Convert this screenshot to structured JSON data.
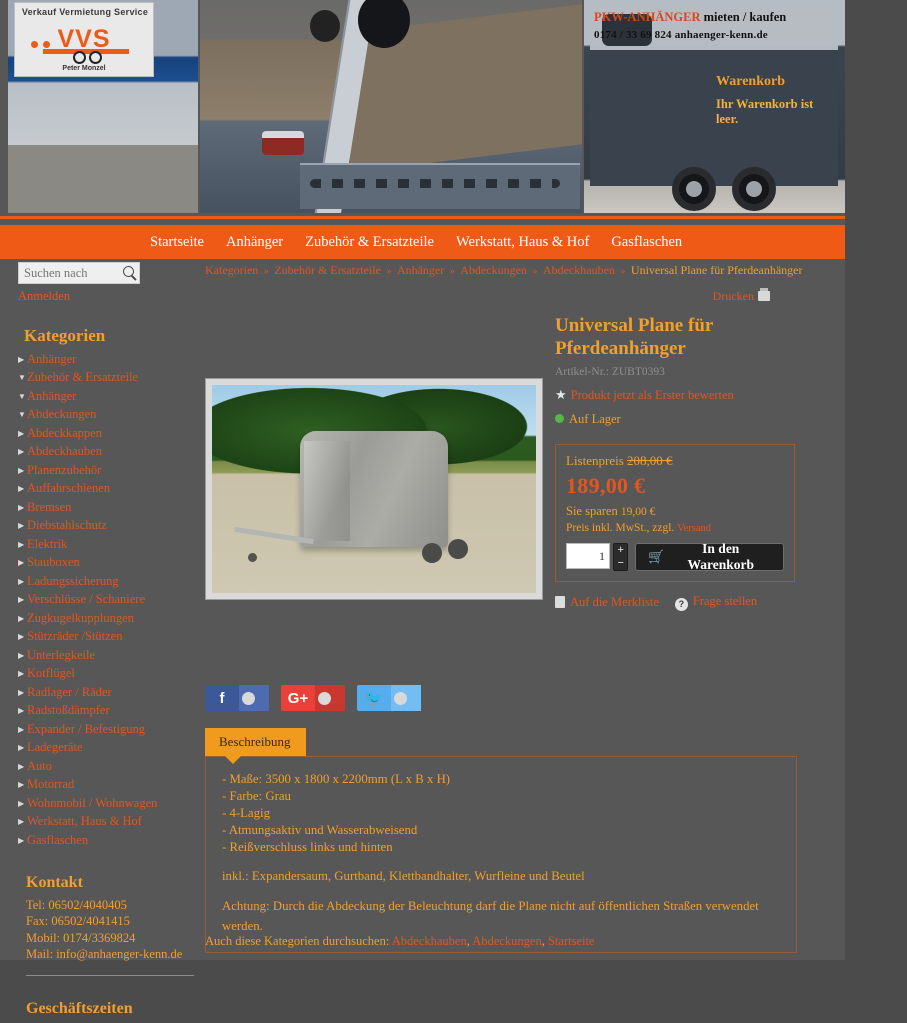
{
  "header": {
    "logo": {
      "arc_text": "Verkauf  Vermietung  Service",
      "brand": "VVS",
      "sub": "Peter Monzel"
    },
    "promo_line1_highlight": "PKW-ANHÄNGER",
    "promo_line1_rest": " mieten / kaufen",
    "promo_line2": "0174 / 33 69 824    anhaenger-kenn.de",
    "cart_title": "Warenkorb",
    "cart_message": "Ihr Warenkorb ist leer."
  },
  "nav": {
    "items": [
      "Startseite",
      "Anhänger",
      "Zubehör & Ersatzteile",
      "Werkstatt, Haus & Hof",
      "Gasflaschen"
    ]
  },
  "search": {
    "placeholder": "Suchen nach",
    "value": "",
    "login_label": "Anmelden"
  },
  "sidebar": {
    "categories_heading": "Kategorien",
    "items": [
      {
        "label": "Anhänger",
        "level": 0,
        "marker": "right"
      },
      {
        "label": "Zubehör & Ersatzteile",
        "level": 0,
        "marker": "down"
      },
      {
        "label": "Anhänger",
        "level": 1,
        "marker": "down"
      },
      {
        "label": "Abdeckungen",
        "level": 2,
        "marker": "down"
      },
      {
        "label": "Abdeckkappen",
        "level": 3,
        "marker": "right"
      },
      {
        "label": "Abdeckhauben",
        "level": 3,
        "marker": "right"
      },
      {
        "label": "Planenzubehör",
        "level": 3,
        "marker": "right"
      },
      {
        "label": "Auffahrschienen",
        "level": 2,
        "marker": "right"
      },
      {
        "label": "Bremsen",
        "level": 2,
        "marker": "right"
      },
      {
        "label": "Diebstahlschutz",
        "level": 2,
        "marker": "right"
      },
      {
        "label": "Elektrik",
        "level": 2,
        "marker": "right"
      },
      {
        "label": "Stauboxen",
        "level": 2,
        "marker": "right"
      },
      {
        "label": "Ladungssicherung",
        "level": 2,
        "marker": "right"
      },
      {
        "label": "Verschlüsse / Schaniere",
        "level": 2,
        "marker": "right"
      },
      {
        "label": "Zugkugelkupplungen",
        "level": 2,
        "marker": "right"
      },
      {
        "label": "Stützräder /Stützen",
        "level": 2,
        "marker": "right"
      },
      {
        "label": "Unterlegkeile",
        "level": 2,
        "marker": "right"
      },
      {
        "label": "Kotflügel",
        "level": 2,
        "marker": "right"
      },
      {
        "label": "Radlager / Räder",
        "level": 2,
        "marker": "right"
      },
      {
        "label": "Radstoßdämpfer",
        "level": 2,
        "marker": "right"
      },
      {
        "label": "Expander / Befestigung",
        "level": 2,
        "marker": "right"
      },
      {
        "label": "Ladegeräte",
        "level": 2,
        "marker": "right"
      },
      {
        "label": "Auto",
        "level": 1,
        "marker": "right"
      },
      {
        "label": "Motorrad",
        "level": 1,
        "marker": "right"
      },
      {
        "label": "Wohnmobil / Wohnwagen",
        "level": 1,
        "marker": "right"
      },
      {
        "label": "Werkstatt, Haus & Hof",
        "level": 0,
        "marker": "right"
      },
      {
        "label": "Gasflaschen",
        "level": 0,
        "marker": "right"
      }
    ],
    "contact_heading": "Kontakt",
    "contact_lines": [
      "Tel: 06502/4040405",
      "Fax: 06502/4041415",
      "Mobil: 0174/3369824",
      "Mail: info@anhaenger-kenn.de"
    ],
    "hours_heading": "Geschäftszeiten"
  },
  "breadcrumb": {
    "items": [
      "Kategorien",
      "Zubehör & Ersatzteile",
      "Anhänger",
      "Abdeckungen",
      "Abdeckhauben"
    ],
    "current": "Universal Plane für Pferdeanhänger",
    "separator": "»",
    "print_label": "Drucken"
  },
  "product": {
    "title": "Universal Plane für Pferdeanhänger",
    "article_label": "Artikel-Nr.: ZUBT0393",
    "review_link": "Produkt jetzt als Erster bewerten",
    "stock_label": "Auf Lager",
    "list_price_label": "Listenpreis",
    "list_price": "208,00 €",
    "price": "189,00 €",
    "savings_label": "Sie sparen",
    "savings_amount": "19,00 €",
    "tax_note": "Preis inkl. MwSt., zzgl.",
    "shipping_link": "Versand",
    "quantity": "1",
    "plus_label": "+",
    "minus_label": "−",
    "add_to_cart_label": "In den Warenkorb",
    "wishlist_label": "Auf die Merkliste",
    "question_label": "Frage stellen"
  },
  "social": [
    {
      "network": "facebook",
      "glyph": "f"
    },
    {
      "network": "google-plus",
      "glyph": "G+"
    },
    {
      "network": "twitter",
      "glyph": "🐦"
    }
  ],
  "description": {
    "tab_label": "Beschreibung",
    "specs": [
      "- Maße: 3500 x 1800 x 2200mm (L x B x H)",
      "- Farbe: Grau",
      "- 4-Lagig",
      "- Atmungsaktiv und Wasserabweisend",
      "- Reißverschluss links und hinten"
    ],
    "included": "inkl.: Expandersaum, Gurtband, Klettbandhalter, Wurfleine und Beutel",
    "warning": "Achtung: Durch die Abdeckung der Beleuchtung darf die Plane nicht auf öffentlichen Straßen verwendet werden."
  },
  "also_browse": {
    "label": "Auch diese Kategorien durchsuchen:",
    "links": [
      "Abdeckhauben",
      "Abdeckungen",
      "Startseite"
    ]
  },
  "colors": {
    "orange": "#ef5a17",
    "link": "#e4551f",
    "amber": "#f0a02c",
    "page_bg": "#575757",
    "outer_bg": "#4b4b4b",
    "tab": "#f09a1e",
    "stock_green": "#53b944"
  }
}
